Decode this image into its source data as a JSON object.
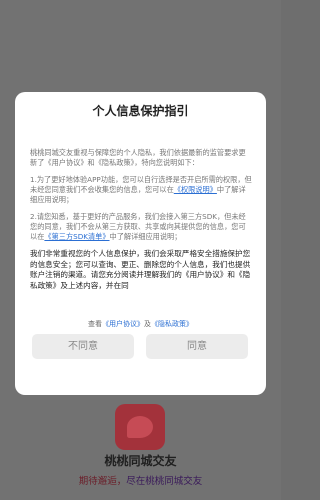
{
  "splash": {
    "app_name": "桃桃同城交友",
    "slogan_part1": "期待邂逅，",
    "slogan_part2": "尽在桃桃同城交友"
  },
  "dialog": {
    "title": "个人信息保护指引",
    "intro": "桃桃同城交友重视与保障您的个人隐私，我们依据最新的监管要求更新了《用户协议》和《隐私政策》，特向您说明如下：",
    "item1_text": "1.为了更好地体验APP功能，您可以自行选择是否开启所需的权限，但未经您同意我们不会收集您的信息，您可以在",
    "item1_link": "《权限说明》",
    "item1_tail": "中了解详细应用说明；",
    "item2_text": "2.请您知悉，基于更好的产品服务，我们会接入第三方SDK，但未经您的同意，我们不会从第三方获取、共享或向其提供您的信息，您可以在",
    "item2_link": "《第三方SDK清单》",
    "item2_tail": "中了解详细应用说明；",
    "notice": "我们非常重视您的个人信息保护，我们会采取严格安全措施保护您的信息安全；您可以查询、更正、删除您的个人信息，我们也提供账户注销的渠道。请您充分阅读并理解我们的《用户协议》和《隐私政策》及上述内容，并在同",
    "footer_prefix": "查看",
    "footer_user_agreement": "《用户协议》",
    "footer_and": "及",
    "footer_privacy_policy": "《隐私政策》",
    "disagree_label": "不同意",
    "agree_label": "同意"
  }
}
